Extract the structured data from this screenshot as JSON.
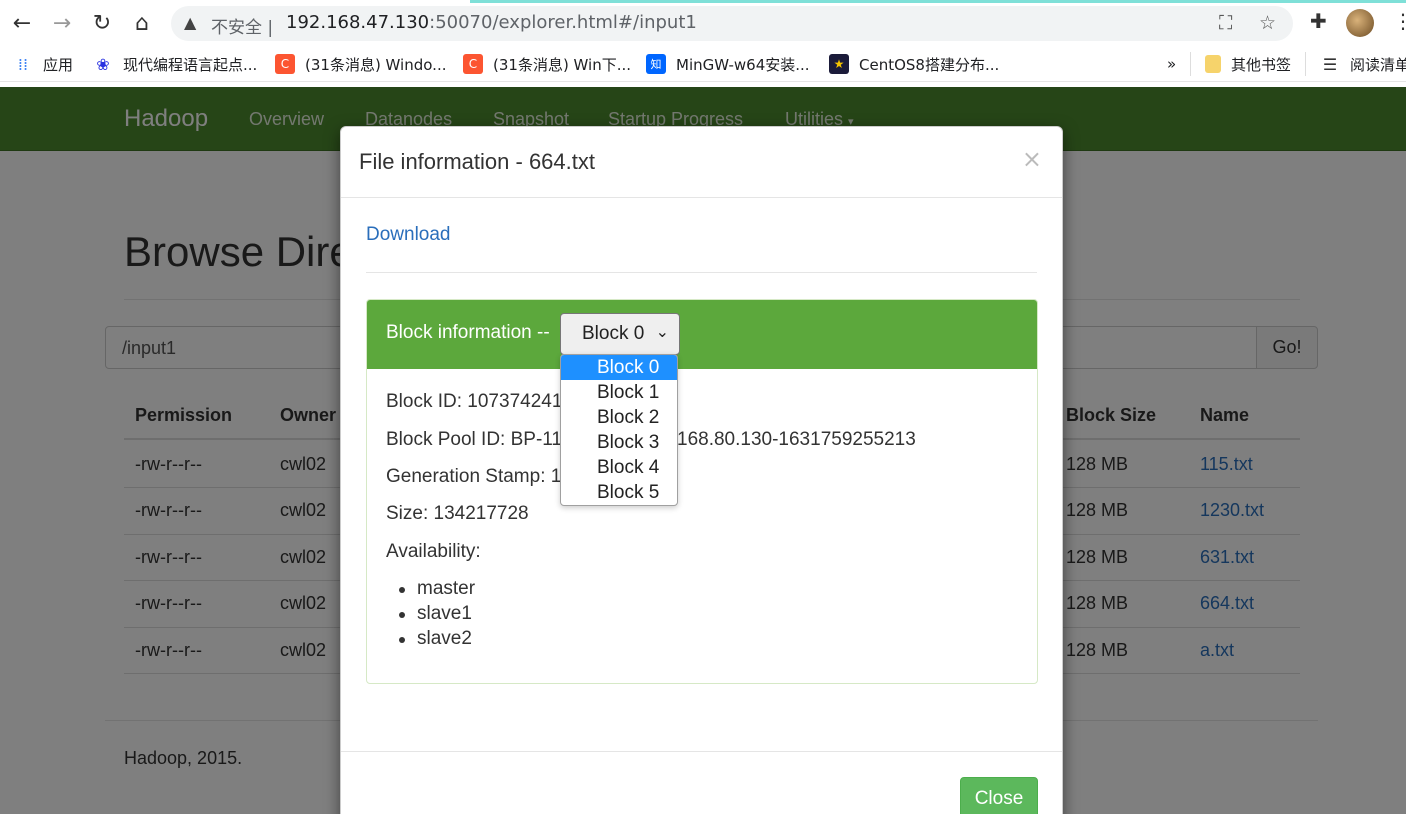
{
  "browser": {
    "insecure_label": "不安全",
    "url_host": "192.168.47.130",
    "url_rest": ":50070/explorer.html#/input1",
    "bookmarks": [
      {
        "label": "应用",
        "icon": "apps-grid-icon",
        "color": "#4285f4"
      },
      {
        "label": "现代编程语言起点...",
        "icon": "baidu-paw-icon",
        "color": "#2932e1"
      },
      {
        "label": "(31条消息) Windo...",
        "icon": "csdn-c-icon",
        "color": "#fc5531"
      },
      {
        "label": "(31条消息) Win下...",
        "icon": "csdn-c-icon",
        "color": "#fc5531"
      },
      {
        "label": "MinGW-w64安装...",
        "icon": "zhihu-icon",
        "color": "#0066ff"
      },
      {
        "label": "CentOS8搭建分布...",
        "icon": "star-favicon-icon",
        "color": "#1b1b3a"
      }
    ],
    "more_label": "»",
    "other_bookmarks": "其他书签",
    "reading_list": "阅读清单"
  },
  "navbar": {
    "brand": "Hadoop",
    "links": [
      "Overview",
      "Datanodes",
      "Snapshot",
      "Startup Progress",
      "Utilities"
    ]
  },
  "page": {
    "title": "Browse Directory",
    "path_value": "/input1",
    "go_label": "Go!",
    "columns": [
      "Permission",
      "Owner",
      "Block Size",
      "Name"
    ],
    "rows": [
      {
        "permission": "-rw-r--r--",
        "owner": "cwl02",
        "block_size": "128 MB",
        "name": "115.txt"
      },
      {
        "permission": "-rw-r--r--",
        "owner": "cwl02",
        "block_size": "128 MB",
        "name": "1230.txt"
      },
      {
        "permission": "-rw-r--r--",
        "owner": "cwl02",
        "block_size": "128 MB",
        "name": "631.txt"
      },
      {
        "permission": "-rw-r--r--",
        "owner": "cwl02",
        "block_size": "128 MB",
        "name": "664.txt"
      },
      {
        "permission": "-rw-r--r--",
        "owner": "cwl02",
        "block_size": "128 MB",
        "name": "a.txt"
      }
    ],
    "footer": "Hadoop, 2015."
  },
  "modal": {
    "title": "File information - 664.txt",
    "close_x": "×",
    "download_label": "Download",
    "block_info_label": "Block information --",
    "selected_block": "Block 0",
    "block_options": [
      "Block 0",
      "Block 1",
      "Block 2",
      "Block 3",
      "Block 4",
      "Block 5"
    ],
    "block_id_line": "Block ID: 107374241",
    "block_pool_line": "Block Pool ID: BP-110",
    "block_pool_tail": "168.80.130-1631759255213",
    "gen_stamp_line": "Generation Stamp: 10",
    "size_line": "Size: 134217728",
    "availability_label": "Availability:",
    "availability": [
      "master",
      "slave1",
      "slave2"
    ],
    "close_button": "Close"
  }
}
